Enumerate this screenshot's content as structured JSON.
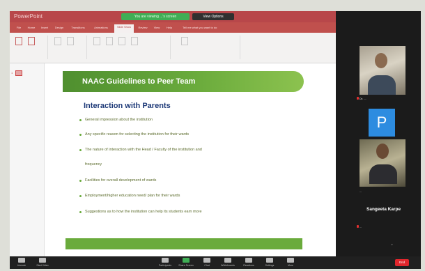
{
  "window": {
    "app_name": "PowerPoint",
    "share_indicator": "You are viewing ...'s screen",
    "view_options": "View Options"
  },
  "ribbon": {
    "tabs": [
      "File",
      "Home",
      "Insert",
      "Design",
      "Transitions",
      "Animations",
      "Slide Show",
      "Review",
      "View",
      "Help"
    ],
    "active_tab_index": 6,
    "tell_me": "Tell me what you want to do"
  },
  "slide": {
    "number": "1",
    "title": "NAAC Guidelines to Peer Team",
    "subtitle": "Interaction with Parents",
    "bullets": [
      "General impression about the institution",
      "Any specific reason for selecting the institution for their wards",
      "The nature of interaction with the Head / Faculty of the institution and",
      "frequency",
      "Facilities for overall development of wards",
      "Employment/higher education need/ plan for their wards",
      "Suggestions as to how the institution can help its students earn more"
    ],
    "accent_color": "#6aab3c",
    "subtitle_color": "#1e3a78"
  },
  "participants": {
    "tile1_name": "Dr. ...",
    "tile2_initial": "P",
    "tile2_name": "...",
    "tile3_name": "...",
    "highlight_name": "Sangeeta Karpe",
    "bottom_name": "..."
  },
  "toolbar": {
    "items": [
      {
        "label": "Unmute",
        "icon": "mic-icon"
      },
      {
        "label": "Start Video",
        "icon": "video-icon"
      },
      {
        "label": "Participants",
        "icon": "participants-icon"
      },
      {
        "label": "Share Screen",
        "icon": "share-icon"
      },
      {
        "label": "Chat",
        "icon": "chat-icon"
      },
      {
        "label": "Whiteboards",
        "icon": "whiteboard-icon"
      },
      {
        "label": "Reactions",
        "icon": "reactions-icon"
      },
      {
        "label": "Settings",
        "icon": "gear-icon"
      },
      {
        "label": "More",
        "icon": "more-icon"
      }
    ],
    "end_label": "End"
  }
}
